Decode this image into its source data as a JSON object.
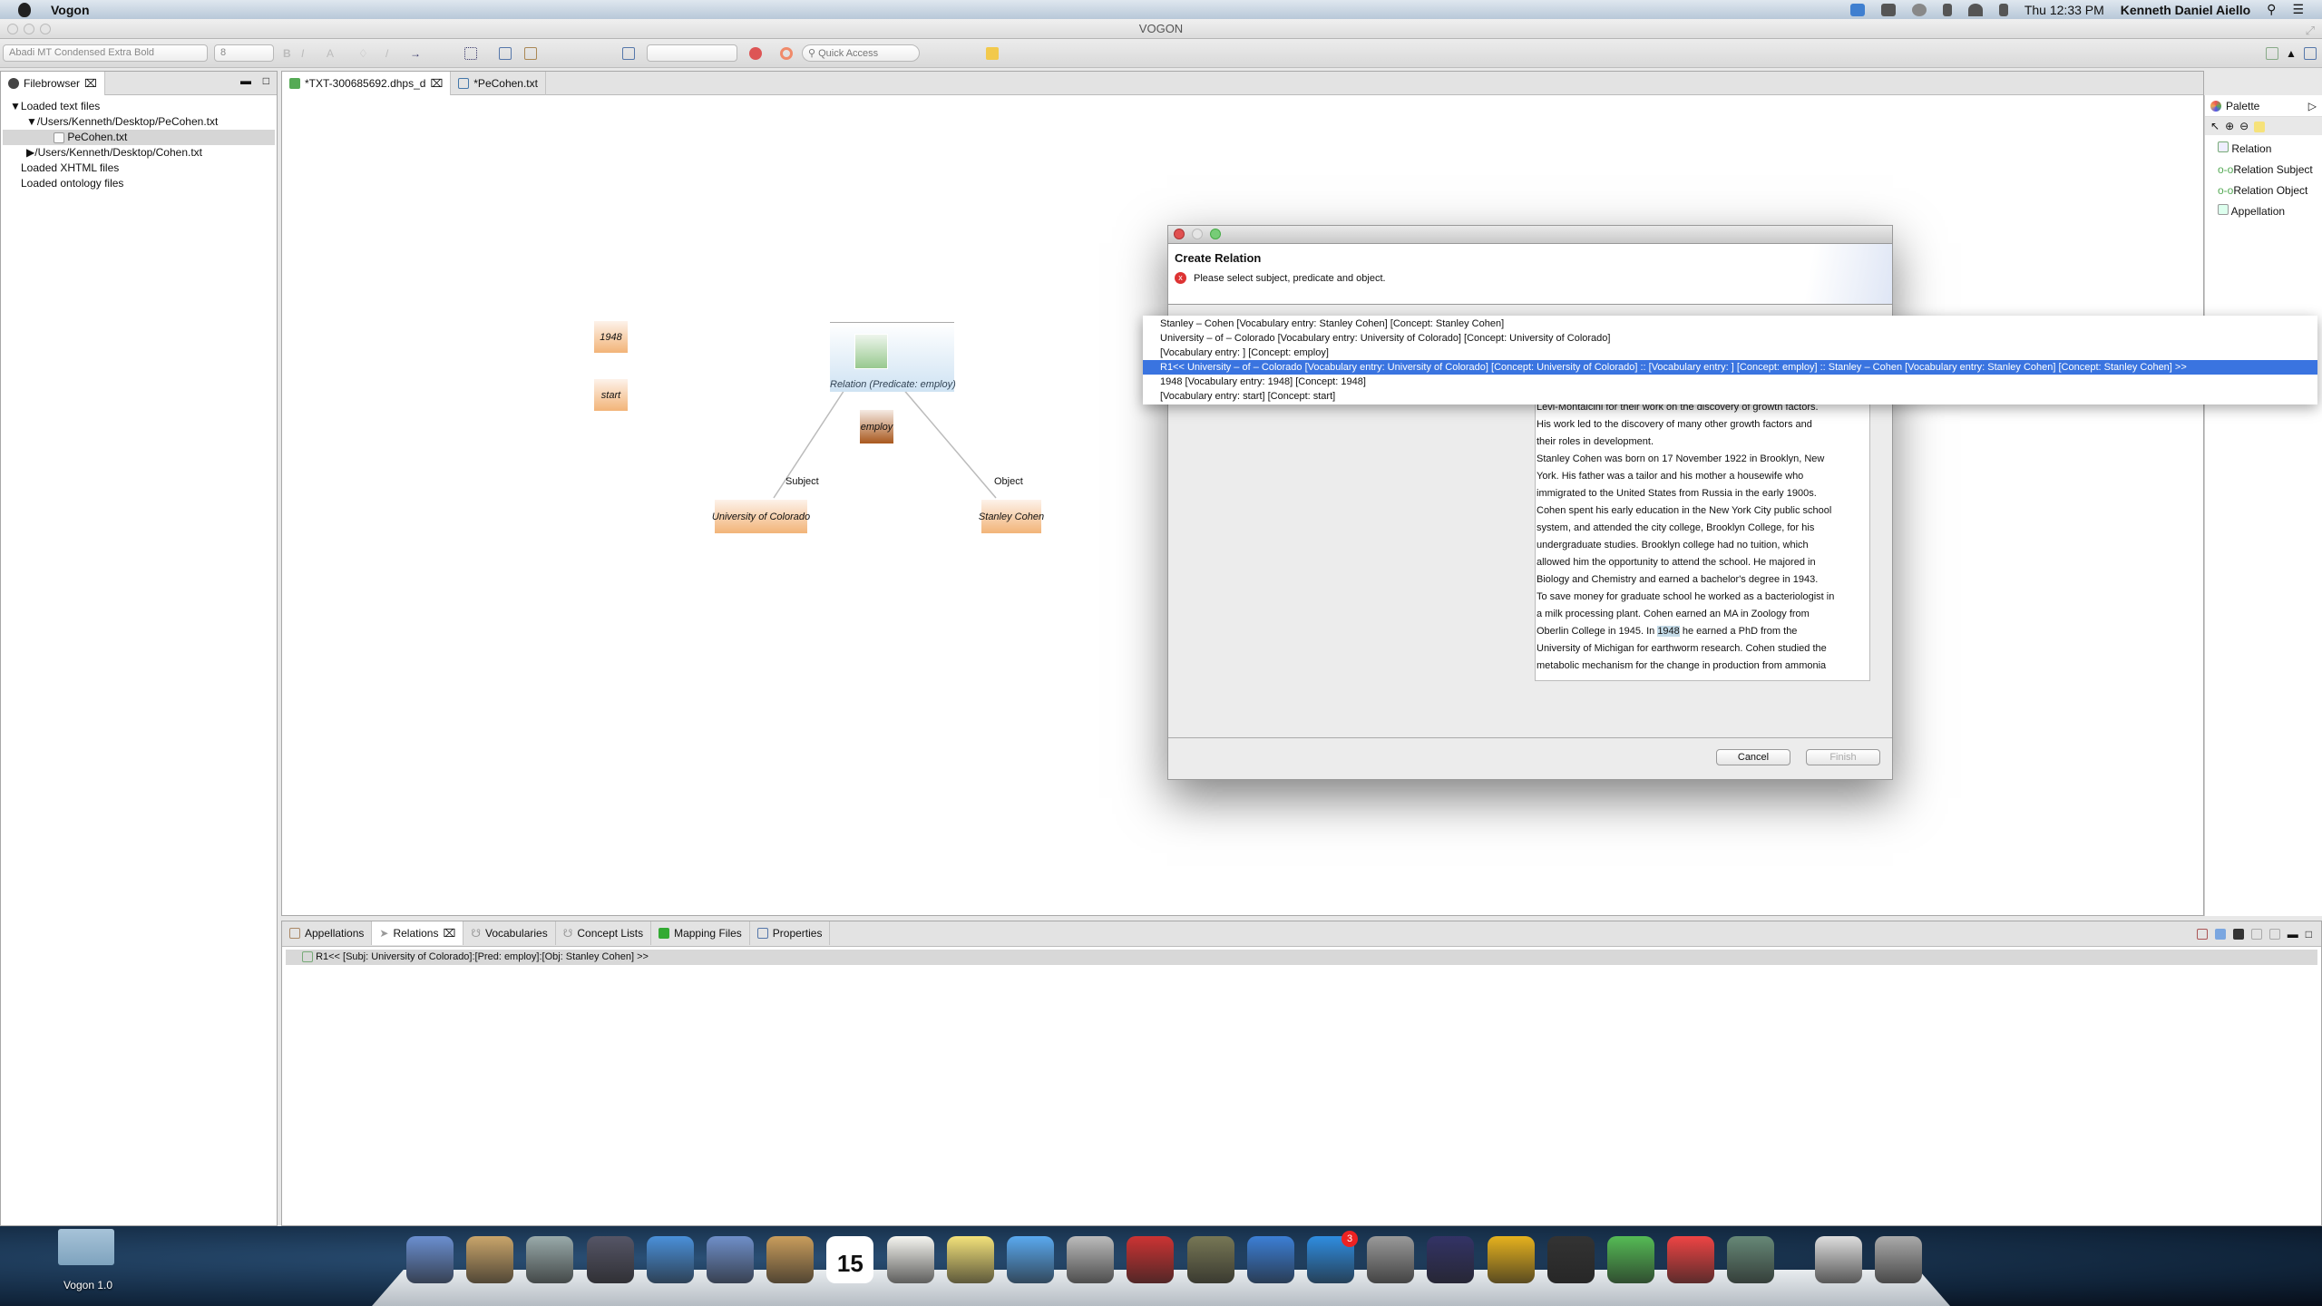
{
  "menubar": {
    "app_name": "Vogon",
    "clock": "Thu 12:33 PM",
    "user": "Kenneth Daniel Aiello",
    "icons": [
      "dropbox-icon",
      "evernote-icon",
      "time-machine-icon",
      "bluetooth-icon",
      "wifi-icon",
      "volume-icon",
      "spotlight-icon",
      "notification-center-icon"
    ]
  },
  "window": {
    "title": "VOGON"
  },
  "toolbar": {
    "font_family": "Abadi MT Condensed Extra Bold",
    "font_size": "8",
    "quick_access_placeholder": "Quick Access"
  },
  "filebrowser": {
    "tab_label": "Filebrowser",
    "tree": [
      {
        "label": "Loaded text files",
        "level": 0,
        "expanded": true
      },
      {
        "label": "/Users/Kenneth/Desktop/PeCohen.txt",
        "level": 1,
        "expanded": true
      },
      {
        "label": "PeCohen.txt",
        "level": 2,
        "selected": true
      },
      {
        "label": "/Users/Kenneth/Desktop/Cohen.txt",
        "level": 1,
        "expanded": false
      },
      {
        "label": "Loaded XHTML files",
        "level": 0
      },
      {
        "label": "Loaded ontology files",
        "level": 0
      }
    ]
  },
  "editor": {
    "tabs": [
      {
        "label": "*TXT-300685692.dhps_d",
        "active": true
      },
      {
        "label": "*PeCohen.txt",
        "active": false
      }
    ]
  },
  "diagram": {
    "nodes": {
      "n1948": "1948",
      "start": "start",
      "relation": "Relation (Predicate: employ)",
      "employ": "employ",
      "subject_node": "University of Colorado",
      "object_node": "Stanley Cohen"
    },
    "edges": {
      "subject": "Subject",
      "object": "Object"
    }
  },
  "palette": {
    "title": "Palette",
    "items": [
      "Relation",
      "Relation Subject",
      "Relation Object",
      "Appellation"
    ]
  },
  "dialog": {
    "title": "Create Relation",
    "error": "Please select subject, predicate and object.",
    "text_lines": [
      "Levi-Montalcini for their work on the discovery of growth factors.",
      "His work led to the discovery of many other growth factors and",
      "their roles in development.",
      "Stanley Cohen was born on 17 November 1922 in Brooklyn, New",
      "York.  His father was a tailor and his mother a housewife who",
      "immigrated to the United States from Russia in the early 1900s.",
      "Cohen spent his early education in the New York City public school",
      "system, and attended the city college, Brooklyn College, for his",
      "undergraduate studies.  Brooklyn college had no tuition, which",
      "allowed him the opportunity to attend the school.   He majored in",
      "Biology and Chemistry and earned a bachelor's degree in 1943.",
      "To save money for graduate school he worked as a bacteriologist in",
      "a milk processing plant.  Cohen earned an MA in Zoology from"
    ],
    "line_before": "Oberlin College in 1945.  In ",
    "highlight": "1948",
    "line_after": " he earned a PhD from the",
    "text_lines_end": [
      "University of Michigan for earthworm research.  Cohen studied the",
      "metabolic mechanism for the change in production from ammonia"
    ],
    "cancel": "Cancel",
    "finish": "Finish",
    "popup": [
      "Stanley – Cohen [Vocabulary entry: Stanley Cohen]  [Concept: Stanley Cohen]",
      "University – of – Colorado [Vocabulary entry: University of Colorado]  [Concept: University of Colorado]",
      " [Vocabulary entry: ]  [Concept: employ]",
      "R1<< University – of – Colorado [Vocabulary entry: University of Colorado]  [Concept: University of Colorado] ::  [Vocabulary entry: ]  [Concept: employ] :: Stanley – Cohen [Vocabulary entry: Stanley Cohen]  [Concept: Stanley Cohen] >>",
      "1948 [Vocabulary entry: 1948]  [Concept: 1948]",
      " [Vocabulary entry: start]  [Concept: start]"
    ],
    "popup_selected": 3
  },
  "bottom": {
    "tabs": [
      {
        "label": "Appellations"
      },
      {
        "label": "Relations",
        "active": true
      },
      {
        "label": "Vocabularies"
      },
      {
        "label": "Concept Lists"
      },
      {
        "label": "Mapping Files"
      },
      {
        "label": "Properties"
      }
    ],
    "rows": [
      "R1<< [Subj: University of Colorado]:[Pred: employ]:[Obj: Stanley Cohen] >>"
    ]
  },
  "desktop": {
    "volume_label": "Vogon 1.0"
  },
  "dock": {
    "apps": [
      "finder",
      "preview",
      "launchpad",
      "photo-booth",
      "safari",
      "mail",
      "contacts",
      "calendar",
      "reminders",
      "notes",
      "messages",
      "facetime",
      "photo-slideshow",
      "image-capture",
      "itunes",
      "app-store",
      "system-preferences",
      "eclipse",
      "vogon",
      "terminal",
      "evernote",
      "chrome",
      "vim",
      "downloads",
      "trash"
    ],
    "calendar_day": "15",
    "app_store_badge": "3"
  }
}
